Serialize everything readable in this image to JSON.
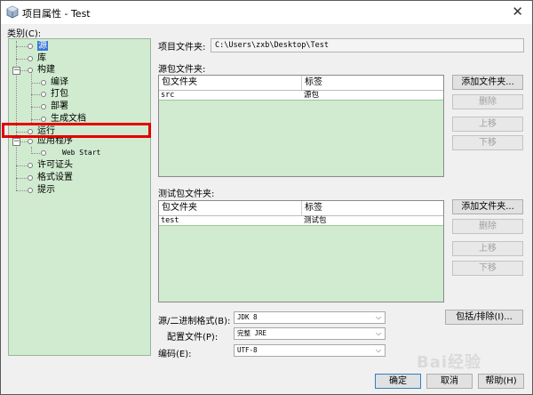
{
  "window": {
    "title": "项目属性 - Test",
    "close_glyph": "✕"
  },
  "categories": {
    "label": "类别(C):",
    "items": {
      "source": "源",
      "libraries": "库",
      "build": "构建",
      "compile": "编译",
      "package": "打包",
      "deploy": "部署",
      "documenting": "生成文档",
      "run": "运行",
      "application": "应用程序",
      "web_start": "Web Start",
      "license": "许可证头",
      "formatting": "格式设置",
      "hints": "提示"
    },
    "selected": "源",
    "highlighted": "运行",
    "highlight_color": "#e30000"
  },
  "project_folder": {
    "label": "项目文件夹:",
    "value": "C:\\Users\\zxb\\Desktop\\Test"
  },
  "source_folders": {
    "label": "源包文件夹:",
    "columns": [
      "包文件夹",
      "标签"
    ],
    "rows": [
      {
        "folder": "src",
        "label": "源包"
      }
    ],
    "buttons": {
      "add": "添加文件夹...",
      "remove": "删除",
      "up": "上移",
      "down": "下移"
    }
  },
  "test_folders": {
    "label": "测试包文件夹:",
    "columns": [
      "包文件夹",
      "标签"
    ],
    "rows": [
      {
        "folder": "test",
        "label": "测试包"
      }
    ],
    "buttons": {
      "add": "添加文件夹...",
      "remove": "删除",
      "up": "上移",
      "down": "下移"
    }
  },
  "settings": {
    "binary_format_label": "源/二进制格式(B):",
    "binary_format_value": "JDK 8",
    "profile_label": "配置文件(P):",
    "profile_value": "完整 JRE",
    "encoding_label": "编码(E):",
    "encoding_value": "UTF-8",
    "include_exclude_button": "包括/排除(I)..."
  },
  "footer": {
    "ok": "确定",
    "cancel": "取消",
    "help": "帮助(H)"
  },
  "watermark": "Bai经验",
  "colors": {
    "tree_bg": "#d0ebd0",
    "selection": "#3875d7",
    "default_button_border": "#3c7fb1"
  }
}
